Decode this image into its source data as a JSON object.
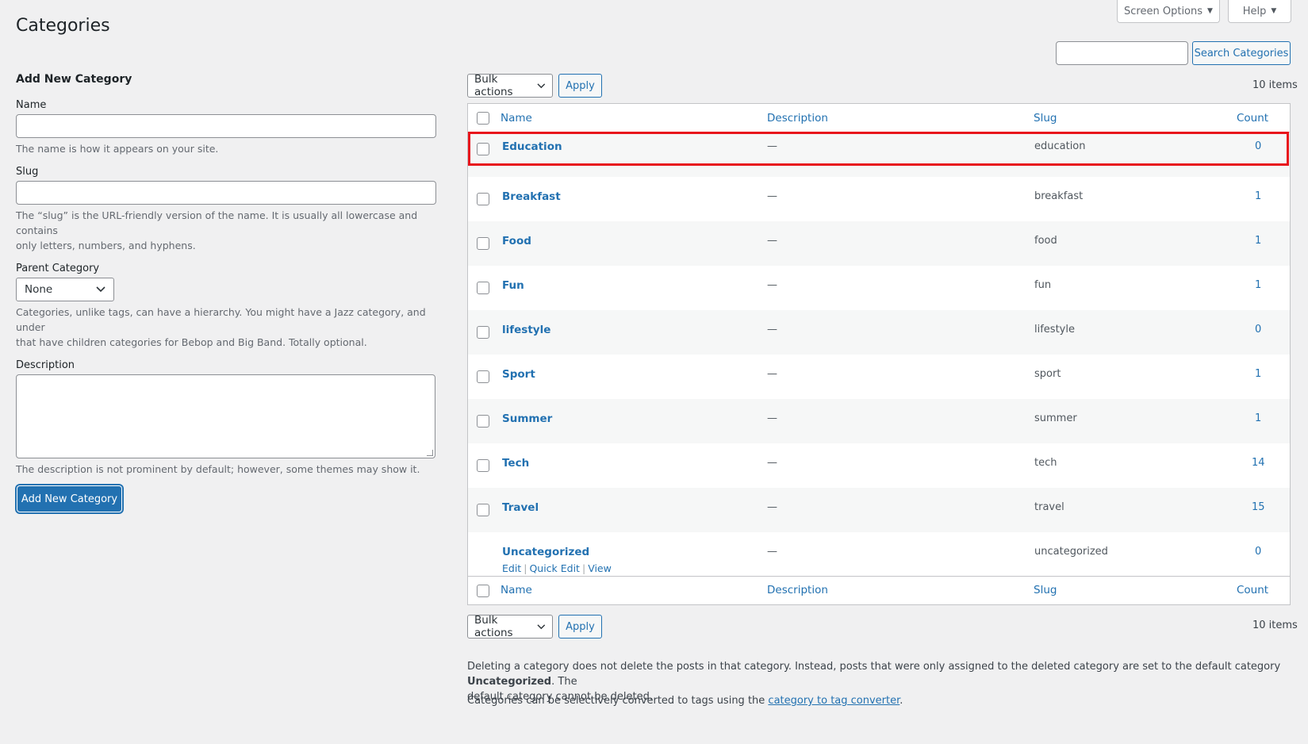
{
  "header": {
    "title": "Categories",
    "screen_options": "Screen Options",
    "help": "Help",
    "search_button": "Search Categories",
    "search_value": ""
  },
  "form": {
    "title": "Add New Category",
    "name_label": "Name",
    "name_value": "",
    "name_help": "The name is how it appears on your site.",
    "slug_label": "Slug",
    "slug_value": "",
    "slug_help_1": "The “slug” is the URL-friendly version of the name. It is usually all lowercase and contains",
    "slug_help_2": "only letters, numbers, and hyphens.",
    "parent_label": "Parent Category",
    "parent_selected": "None",
    "parent_help_1": "Categories, unlike tags, can have a hierarchy. You might have a Jazz category, and under",
    "parent_help_2": "that have children categories for Bebop and Big Band. Totally optional.",
    "description_label": "Description",
    "description_value": "",
    "description_help": "The description is not prominent by default; however, some themes may show it.",
    "submit": "Add New Category"
  },
  "toolbar": {
    "bulk_selected": "Bulk actions",
    "apply": "Apply",
    "items_count": "10 items"
  },
  "table": {
    "columns": {
      "name": "Name",
      "description": "Description",
      "slug": "Slug",
      "count": "Count"
    },
    "rows": [
      {
        "name": "Education",
        "description": "—",
        "slug": "education",
        "count": "0"
      },
      {
        "name": "Breakfast",
        "description": "—",
        "slug": "breakfast",
        "count": "1"
      },
      {
        "name": "Food",
        "description": "—",
        "slug": "food",
        "count": "1"
      },
      {
        "name": "Fun",
        "description": "—",
        "slug": "fun",
        "count": "1"
      },
      {
        "name": "lifestyle",
        "description": "—",
        "slug": "lifestyle",
        "count": "0"
      },
      {
        "name": "Sport",
        "description": "—",
        "slug": "sport",
        "count": "1"
      },
      {
        "name": "Summer",
        "description": "—",
        "slug": "summer",
        "count": "1"
      },
      {
        "name": "Tech",
        "description": "—",
        "slug": "tech",
        "count": "14"
      },
      {
        "name": "Travel",
        "description": "—",
        "slug": "travel",
        "count": "15"
      },
      {
        "name": "Uncategorized",
        "description": "—",
        "slug": "uncategorized",
        "count": "0"
      }
    ],
    "row_actions": {
      "edit": "Edit",
      "quick_edit": "Quick Edit",
      "view": "View"
    }
  },
  "footnote": {
    "line1_a": "Deleting a category does not delete the posts in that category. Instead, posts that were only assigned to the deleted category are set to the default category",
    "line1_bold": "Uncategorized",
    "line1_b": ". The",
    "line2": "default category cannot be deleted.",
    "line3_a": "Categories can be selectively converted to tags using the",
    "line3_link": "category to tag converter",
    "line3_b": "."
  },
  "colors": {
    "accent": "#2271b1",
    "highlight": "#e8141c"
  }
}
